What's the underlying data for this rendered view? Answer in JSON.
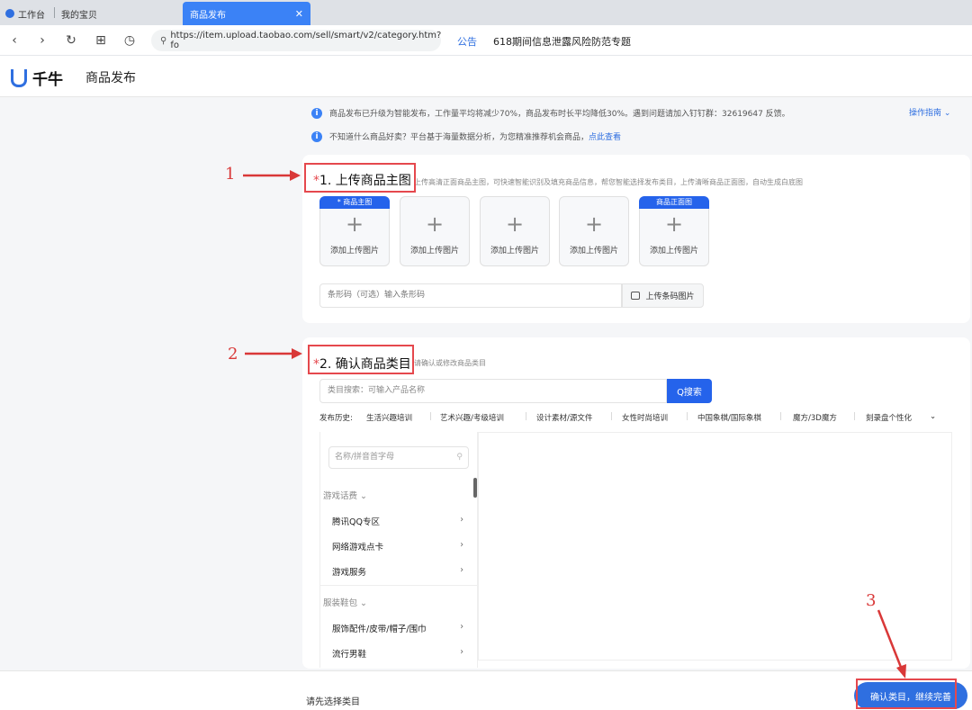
{
  "browser": {
    "tabs": [
      {
        "label": "工作台"
      },
      {
        "label": "我的宝贝"
      },
      {
        "label": "商品发布",
        "active": true
      }
    ],
    "url": "https://item.upload.taobao.com/sell/smart/v2/category.htm?fo",
    "notice_label": "公告",
    "notice_topic": "618期间信息泄露风险防范专题"
  },
  "app": {
    "logo_text": "千牛",
    "page_title": "商品发布",
    "brand_color": "#2f6fe0"
  },
  "info": {
    "line1": "商品发布已升级为智能发布，工作量平均将减少70%，商品发布时长平均降低30%。遇到问题请加入钉钉群：32619647 反馈。",
    "line2_text": "不知道什么商品好卖？平台基于海量数据分析，为您精准推荐机会商品，",
    "line2_link": "点此查看",
    "guide_label": "操作指南"
  },
  "section1": {
    "required_mark": "*",
    "title": "1. 上传商品主图",
    "desc": "上传高清正面商品主图，可快速智能识别及填充商品信息，帮您智能选择发布类目，上传清晰商品正面图，自动生成白底图",
    "slots": [
      {
        "tag": "* 商品主图",
        "label": "添加上传图片"
      },
      {
        "tag": "",
        "label": "添加上传图片"
      },
      {
        "tag": "",
        "label": "添加上传图片"
      },
      {
        "tag": "",
        "label": "添加上传图片"
      },
      {
        "tag": "商品正面图",
        "label": "添加上传图片"
      }
    ],
    "barcode_placeholder": "条形码（可选）输入条形码",
    "barcode_button": "上传条码图片"
  },
  "section2": {
    "required_mark": "*",
    "title": "2. 确认商品类目",
    "desc": "请确认或修改商品类目",
    "search_placeholder": "类目搜索：可输入产品名称",
    "search_button": "Q搜索",
    "history_label": "发布历史:",
    "history": [
      "生活兴趣培训",
      "艺术兴趣/考级培训",
      "设计素材/源文件",
      "女性时尚培训",
      "中国象棋/国际象棋",
      "魔方/3D魔方",
      "刻录盘个性化"
    ],
    "filter_placeholder": "名称/拼音首字母",
    "groups": [
      {
        "name": "游戏话费",
        "items": [
          "腾讯QQ专区",
          "网络游戏点卡",
          "游戏服务"
        ]
      },
      {
        "name": "服装鞋包",
        "items": [
          "服饰配件/皮带/帽子/围巾",
          "流行男鞋"
        ]
      }
    ]
  },
  "footer": {
    "hint": "请先选择类目",
    "confirm_button": "确认类目，继续完善"
  },
  "annotations": {
    "step1": "1",
    "step2": "2",
    "step3": "3",
    "color": "#e5484d"
  }
}
